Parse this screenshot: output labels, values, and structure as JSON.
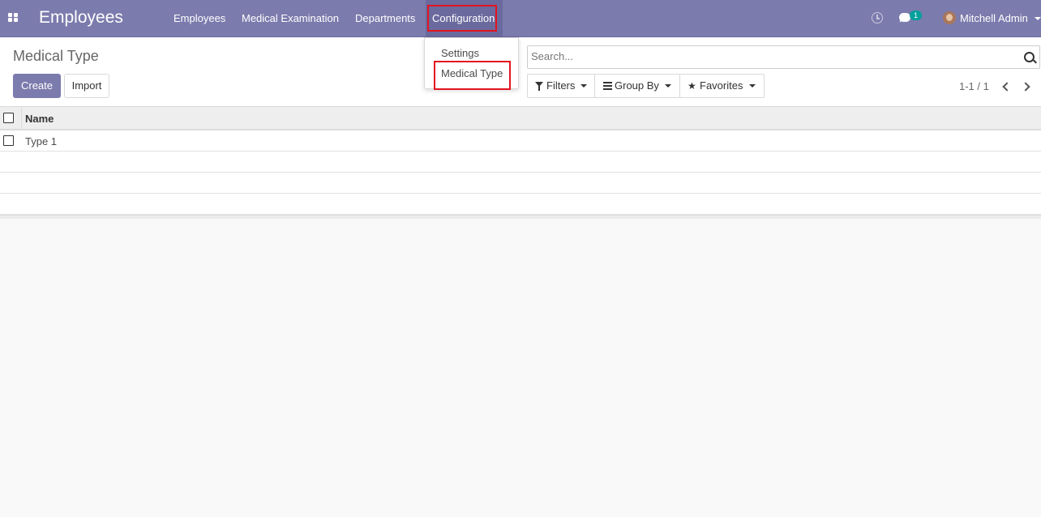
{
  "navbar": {
    "app_name": "Employees",
    "menu": [
      "Employees",
      "Medical Examination",
      "Departments",
      "Configuration"
    ],
    "notification_count": "1",
    "user_name": "Mitchell Admin"
  },
  "dropdown": {
    "items": [
      "Settings",
      "Medical Type"
    ]
  },
  "control_panel": {
    "title": "Medical Type",
    "create_label": "Create",
    "import_label": "Import",
    "search_placeholder": "Search...",
    "filters_label": "Filters",
    "group_by_label": "Group By",
    "favorites_label": "Favorites",
    "pager": "1-1 / 1"
  },
  "list": {
    "columns": [
      "Name"
    ],
    "rows": [
      "Type 1"
    ]
  },
  "colors": {
    "navbar": "#7c7bad",
    "highlight_box": "#e3141e",
    "badge": "#00a09d"
  }
}
